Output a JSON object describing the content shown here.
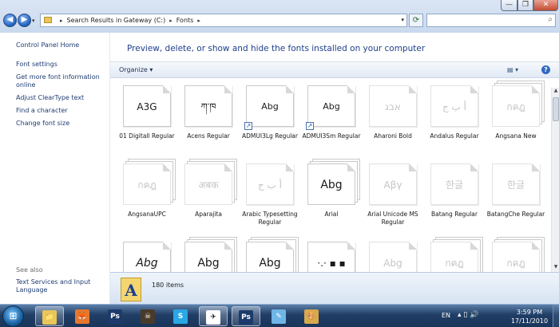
{
  "address": {
    "segments": [
      "Search Results in Gateway (C:)",
      "Fonts"
    ],
    "search_placeholder": ""
  },
  "window_controls": {
    "minimize": "—",
    "maximize": "❐",
    "close": "✕"
  },
  "left_nav": {
    "home": "Control Panel Home",
    "links": [
      "Font settings",
      "Get more font information online",
      "Adjust ClearType text",
      "Find a character",
      "Change font size"
    ],
    "see_also_heading": "See also",
    "see_also_links": [
      "Text Services and Input Language"
    ]
  },
  "banner": {
    "title": "Preview, delete, or show and hide the fonts installed on your computer"
  },
  "toolbar": {
    "organize_label": "Organize",
    "help": "?"
  },
  "fonts": [
    {
      "name": "01 Digitall Regular",
      "sample": "A3G",
      "hidden": false,
      "stack": false,
      "shortcut": false
    },
    {
      "name": "Acens Regular",
      "sample": "ཀ་ཁ",
      "hidden": false,
      "stack": false,
      "shortcut": false
    },
    {
      "name": "ADMUI3Lg Regular",
      "sample": "Abg",
      "hidden": false,
      "stack": false,
      "shortcut": true
    },
    {
      "name": "ADMUI3Sm Regular",
      "sample": "Abg",
      "hidden": false,
      "stack": false,
      "shortcut": true
    },
    {
      "name": "Aharoni Bold",
      "sample": "אבג",
      "hidden": true,
      "stack": false,
      "shortcut": false
    },
    {
      "name": "Andalus Regular",
      "sample": "أ ب ج",
      "hidden": true,
      "stack": false,
      "shortcut": false
    },
    {
      "name": "Angsana New",
      "sample": "กคฎ",
      "hidden": true,
      "stack": true,
      "shortcut": false
    },
    {
      "name": "AngsanaUPC",
      "sample": "กคฎ",
      "hidden": true,
      "stack": true,
      "shortcut": false
    },
    {
      "name": "Aparajita",
      "sample": "अबक",
      "hidden": true,
      "stack": true,
      "shortcut": false
    },
    {
      "name": "Arabic Typesetting Regular",
      "sample": "أ ب ج",
      "hidden": true,
      "stack": false,
      "shortcut": false
    },
    {
      "name": "Arial",
      "sample": "Abg",
      "hidden": false,
      "stack": true,
      "shortcut": false
    },
    {
      "name": "Arial Unicode MS Regular",
      "sample": "Αβγ",
      "hidden": true,
      "stack": false,
      "shortcut": false
    },
    {
      "name": "Batang Regular",
      "sample": "한글",
      "hidden": true,
      "stack": false,
      "shortcut": false
    },
    {
      "name": "BatangChe Regular",
      "sample": "한글",
      "hidden": true,
      "stack": false,
      "shortcut": false
    },
    {
      "name": "",
      "sample": "Abg",
      "hidden": false,
      "stack": false,
      "shortcut": false
    },
    {
      "name": "",
      "sample": "Abg",
      "hidden": false,
      "stack": true,
      "shortcut": false
    },
    {
      "name": "",
      "sample": "Abg",
      "hidden": false,
      "stack": true,
      "shortcut": false
    },
    {
      "name": "",
      "sample": "·.·  ▪  ▪",
      "hidden": false,
      "stack": false,
      "shortcut": false
    },
    {
      "name": "",
      "sample": "Abg",
      "hidden": true,
      "stack": false,
      "shortcut": false
    },
    {
      "name": "",
      "sample": "กคฎ",
      "hidden": true,
      "stack": true,
      "shortcut": false
    },
    {
      "name": "",
      "sample": "กคฎ",
      "hidden": true,
      "stack": true,
      "shortcut": false
    }
  ],
  "details": {
    "count": "180 items",
    "icon_letter": "A"
  },
  "taskbar": {
    "start_icon": "windows-orb-icon",
    "apps": [
      {
        "name": "explorer",
        "label": "📁",
        "color": "#e8c65a",
        "active": true
      },
      {
        "name": "firefox",
        "label": "🦊",
        "color": "#e8772e",
        "active": false
      },
      {
        "name": "photoshop",
        "label": "Ps",
        "color": "#1d3a6b",
        "active": false
      },
      {
        "name": "game",
        "label": "☠",
        "color": "#4a3a2a",
        "active": false
      },
      {
        "name": "skype",
        "label": "S",
        "color": "#2aa7e6",
        "active": false
      },
      {
        "name": "runner",
        "label": "✈",
        "color": "#ffffff",
        "active": true
      },
      {
        "name": "photoshop2",
        "label": "Ps",
        "color": "#1d3a6b",
        "active": true
      },
      {
        "name": "notepad",
        "label": "✎",
        "color": "#6fb6e6",
        "active": false
      },
      {
        "name": "paint",
        "label": "🎨",
        "color": "#d9a94e",
        "active": false
      }
    ],
    "language": "EN",
    "time": "3:59 PM",
    "date": "17/11/2010"
  }
}
